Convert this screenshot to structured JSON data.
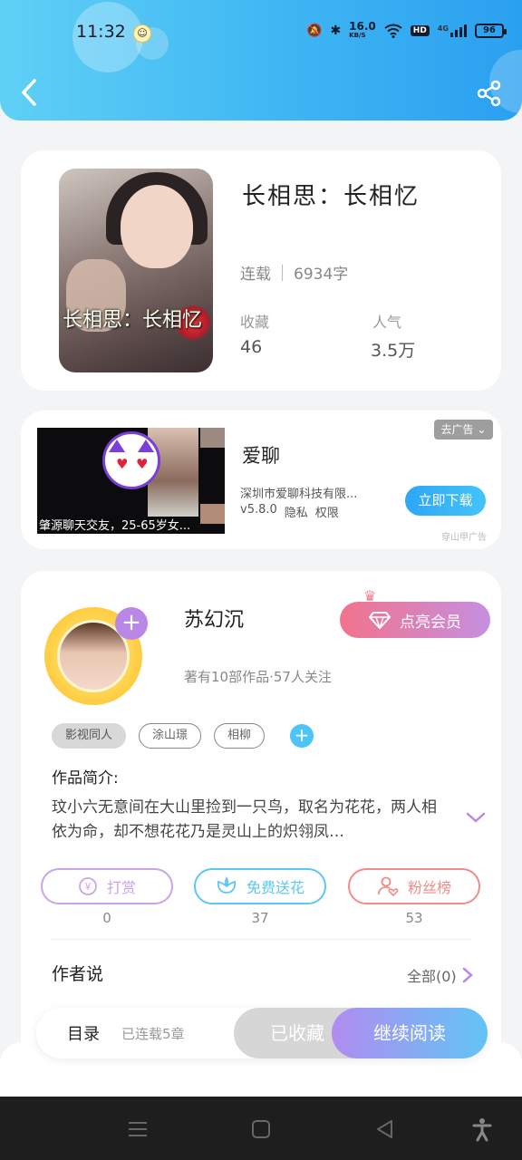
{
  "status_bar": {
    "time": "11:32",
    "net_speed": "16.0",
    "net_unit": "KB/S",
    "hd": "HD",
    "network": "4G",
    "battery": "96"
  },
  "book": {
    "cover_title": "长相思：长相忆",
    "title": "长相思：长相忆",
    "status": "连载",
    "word_count": "6934字",
    "collect_label": "收藏",
    "collect_value": "46",
    "popularity_label": "人气",
    "popularity_value": "3.5万"
  },
  "ad": {
    "badge": "去广告",
    "app_name": "爱聊",
    "company": "深圳市爱聊科技有限...",
    "version": "v5.8.0",
    "privacy": "隐私",
    "permission": "权限",
    "download": "立即下载",
    "source": "穿山甲广告",
    "caption": "肇源聊天交友，25-65岁女..."
  },
  "author": {
    "name": "苏幻沉",
    "stats": "著有10部作品·57人关注",
    "vip_button": "点亮会员",
    "tags": [
      "影视同人",
      "涂山璟",
      "相柳"
    ],
    "intro_label": "作品简介:",
    "intro_text": "玟小六无意间在大山里捡到一只鸟，取名为花花，两人相依为命，却不想花花乃是灵山上的炽翎凤…",
    "actions": [
      {
        "label": "打赏",
        "count": "0",
        "color": "#c9a4ec"
      },
      {
        "label": "免费送花",
        "count": "37",
        "color": "#5cc7f2"
      },
      {
        "label": "粉丝榜",
        "count": "53",
        "color": "#f28b8b"
      }
    ],
    "author_says": "作者说",
    "all_link": "全部(0)"
  },
  "bottom_bar": {
    "toc": "目录",
    "chapters": "已连载5章",
    "favorited": "已收藏",
    "continue_reading": "继续阅读"
  }
}
